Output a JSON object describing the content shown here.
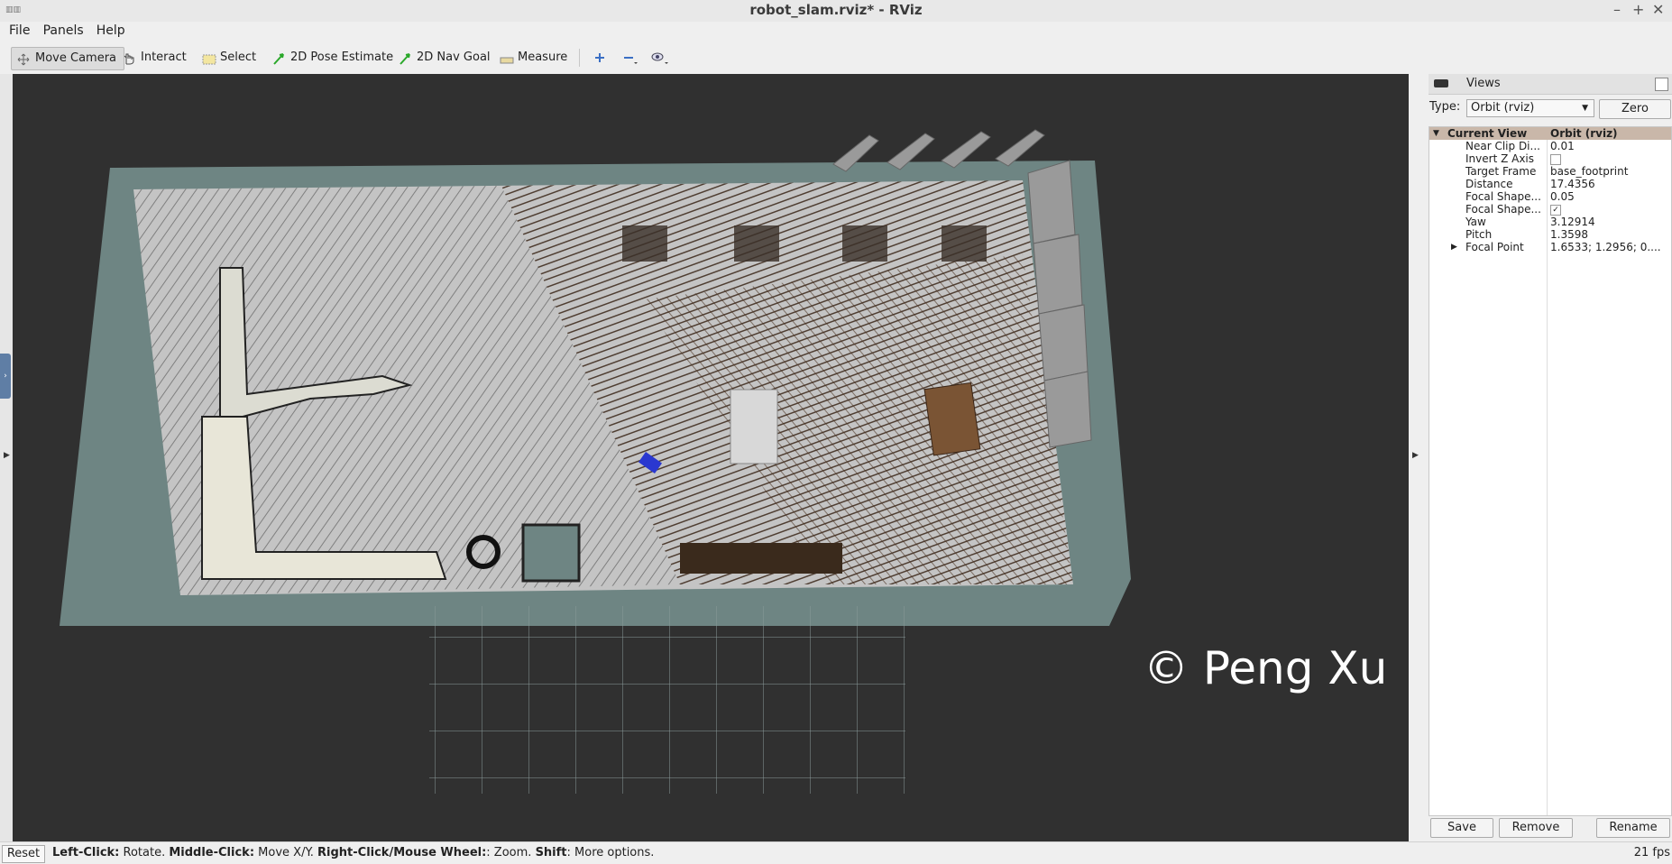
{
  "window": {
    "title": "robot_slam.rviz* - RViz",
    "icon": "rviz-logo-icon"
  },
  "menu": [
    {
      "label": "File"
    },
    {
      "label": "Panels"
    },
    {
      "label": "Help"
    }
  ],
  "toolbar": {
    "move_camera": "Move Camera",
    "interact": "Interact",
    "select": "Select",
    "pose_estimate": "2D Pose Estimate",
    "nav_goal": "2D Nav Goal",
    "measure": "Measure"
  },
  "views_panel": {
    "title": "Views",
    "type_label": "Type:",
    "type_value": "Orbit (rviz)",
    "zero_label": "Zero",
    "current_view_label": "Current View",
    "current_view_value": "Orbit (rviz)",
    "properties": [
      {
        "key": "Near Clip Di...",
        "value": "0.01"
      },
      {
        "key": "Invert Z Axis",
        "value": ""
      },
      {
        "key": "Target Frame",
        "value": "base_footprint"
      },
      {
        "key": "Distance",
        "value": "17.4356"
      },
      {
        "key": "Focal Shape...",
        "value": "0.05"
      },
      {
        "key": "Focal Shape...",
        "value": "✓"
      },
      {
        "key": "Yaw",
        "value": "3.12914"
      },
      {
        "key": "Pitch",
        "value": "1.3598"
      },
      {
        "key": "Focal Point",
        "value": "1.6533; 1.2956; 0...."
      }
    ],
    "buttons": {
      "save": "Save",
      "remove": "Remove",
      "rename": "Rename"
    }
  },
  "status": {
    "reset": "Reset",
    "hint_bold_1": "Left-Click:",
    "hint_1": " Rotate. ",
    "hint_bold_2": "Middle-Click:",
    "hint_2": " Move X/Y. ",
    "hint_bold_3": "Right-Click/Mouse Wheel:",
    "hint_3": ": Zoom. ",
    "hint_bold_4": "Shift",
    "hint_4": ": More options.",
    "fps": "21 fps"
  },
  "watermark": "© Peng Xu",
  "colors": {
    "map_floor": "#c8c8c8",
    "wall_brown": "#4a3324",
    "ground_teal": "#6e8583",
    "robot": "#2a38d0"
  }
}
